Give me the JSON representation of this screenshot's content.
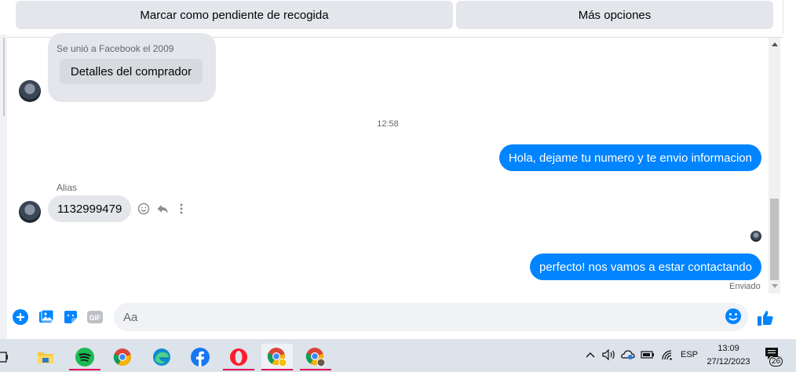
{
  "header": {
    "primary_button": "Marcar como pendiente de recogida",
    "secondary_button": "Más opciones"
  },
  "buyer_card": {
    "joined_text": "Se unió a Facebook el 2009",
    "details_button": "Detalles del comprador"
  },
  "conversation": {
    "timestamp": "12:58",
    "messages": [
      {
        "direction": "outgoing",
        "text": "Hola, dejame tu numero y te envio informacion"
      },
      {
        "direction": "incoming",
        "sender_label": "Alias",
        "text": "1132999479"
      },
      {
        "direction": "outgoing",
        "text": "perfecto! nos vamos a estar contactando",
        "status": "Enviado"
      }
    ]
  },
  "composer": {
    "placeholder": "Aa"
  },
  "taskbar": {
    "apps": [
      "task-view",
      "file-explorer",
      "spotify",
      "chrome",
      "edge",
      "facebook",
      "opera",
      "chrome-profile-1",
      "chrome-profile-2"
    ],
    "tray": {
      "language": "ESP",
      "time": "13:09",
      "date": "27/12/2023",
      "notification_count": "26"
    }
  },
  "colors": {
    "accent": "#0084ff",
    "bubble_incoming": "#e4e6eb",
    "button_bg": "#e4e6eb",
    "taskbar_bg": "#dde3ea",
    "active_underline": "#e0005a"
  }
}
